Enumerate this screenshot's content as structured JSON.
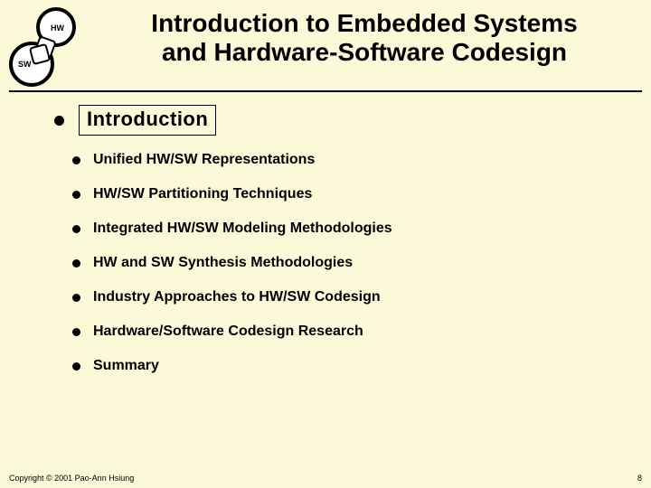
{
  "header": {
    "title_line1": "Introduction to Embedded Systems",
    "title_line2": "and Hardware-Software Codesign",
    "icon_label_top": "HW",
    "icon_label_bottom": "SW"
  },
  "outline": {
    "highlighted": "Introduction",
    "items": [
      "Unified HW/SW Representations",
      "HW/SW Partitioning Techniques",
      "Integrated HW/SW Modeling Methodologies",
      "HW and SW Synthesis Methodologies",
      "Industry Approaches to HW/SW Codesign",
      "Hardware/Software Codesign Research",
      "Summary"
    ]
  },
  "footer": {
    "copyright": "Copyright © 2001 Pao-Ann Hsiung",
    "page": "8"
  }
}
